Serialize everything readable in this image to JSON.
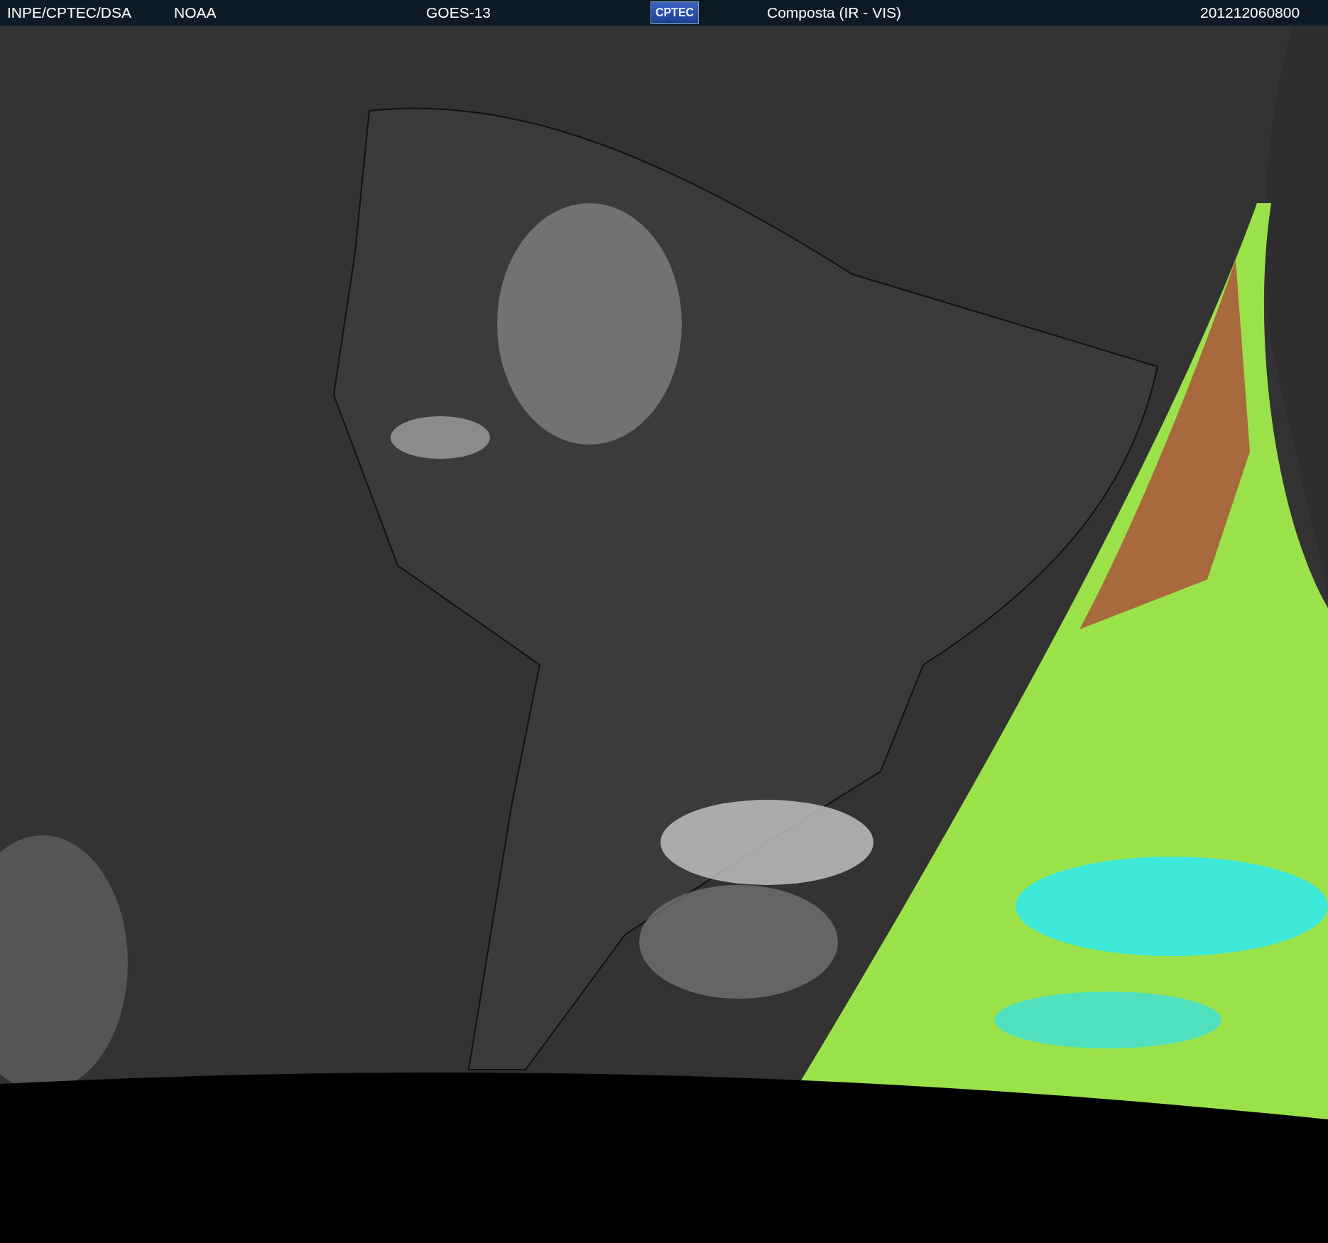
{
  "header": {
    "source": "INPE/CPTEC/DSA",
    "agency": "NOAA",
    "satellite": "GOES-13",
    "logo": "CPTEC",
    "product": "Composta (IR - VIS)",
    "timestamp": "201212060800"
  }
}
